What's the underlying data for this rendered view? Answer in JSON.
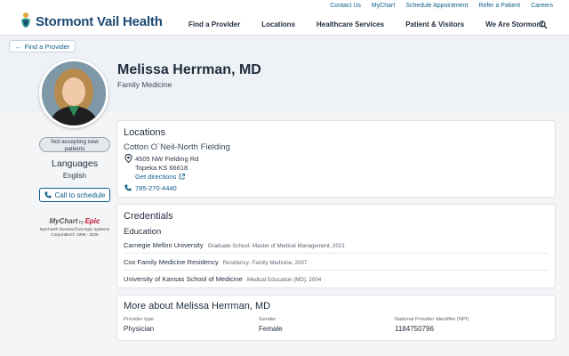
{
  "utility_links": [
    "Contact Us",
    "MyChart",
    "Schedule Appointment",
    "Refer a Patient",
    "Careers"
  ],
  "logo_text": "Stormont Vail Health",
  "main_nav": [
    "Find a Provider",
    "Locations",
    "Healthcare Services",
    "Patient & Visitors",
    "We Are Stormont"
  ],
  "back_link": "Find a Provider",
  "provider": {
    "name": "Melissa Herrman, MD",
    "specialty": "Family Medicine",
    "status": "Not accepting new patients",
    "languages_heading": "Languages",
    "language": "English",
    "call_label": "Call to schedule"
  },
  "mychart": {
    "brand_a": "MyChart",
    "brand_by": " by ",
    "brand_b": "Epic",
    "fine": "MyChart® licensed from Epic Systems Corporation© 1999 - 2026"
  },
  "locations": {
    "heading": "Locations",
    "facility": "Cotton O`Neil-North Fielding",
    "address_line1": "4505 NW Fielding Rd",
    "address_line2": "Topeka KS 66618",
    "directions": "Get directions",
    "phone": "785-270-4440"
  },
  "credentials": {
    "heading": "Credentials",
    "subheading": "Education",
    "items": [
      {
        "school": "Carnegie Mellon University",
        "detail": "Graduate School- Master of Medical Management, 2021"
      },
      {
        "school": "Cox Family Medicine Residency",
        "detail": "Residency- Family Medicine, 2007"
      },
      {
        "school": "University of Kansas School of Medicine",
        "detail": "Medical Education (MD), 2004"
      }
    ]
  },
  "more": {
    "heading": "More about Melissa Herrman, MD",
    "fields": [
      {
        "label": "Provider type",
        "value": "Physician"
      },
      {
        "label": "Gender",
        "value": "Female"
      },
      {
        "label": "National Provider Identifier (NPI)",
        "value": "1184750796"
      }
    ]
  },
  "colors": {
    "brand_navy": "#1d4a73",
    "link_blue": "#0f5e8c",
    "epic_red": "#c8102e"
  }
}
